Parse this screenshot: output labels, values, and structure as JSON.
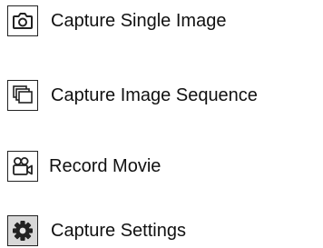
{
  "menu": {
    "items": [
      {
        "label": "Capture Single Image",
        "icon": "camera-icon"
      },
      {
        "label": "Capture Image Sequence",
        "icon": "image-stack-icon"
      },
      {
        "label": "Record Movie",
        "icon": "video-camera-icon"
      },
      {
        "label": "Capture Settings",
        "icon": "gear-icon"
      }
    ]
  }
}
